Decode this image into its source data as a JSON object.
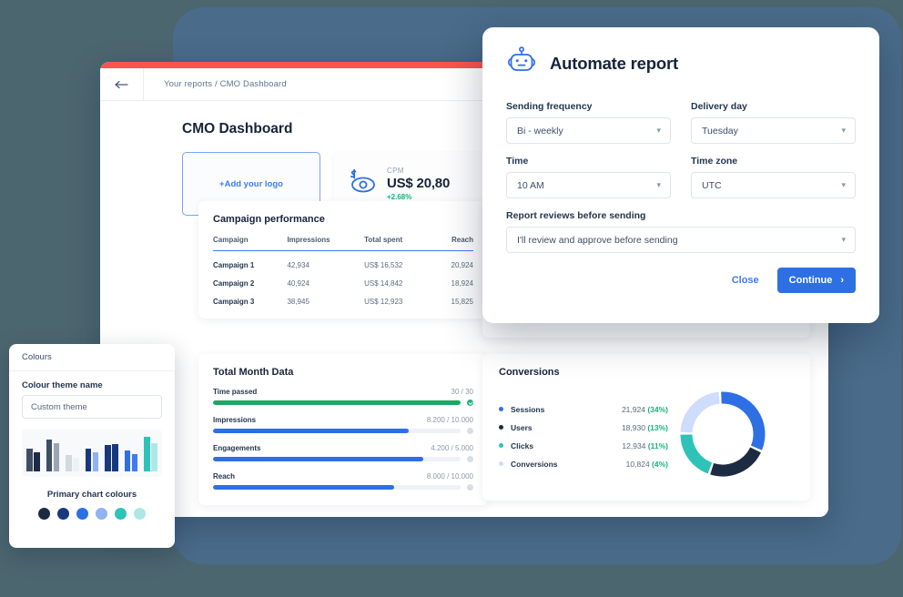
{
  "dashboard": {
    "breadcrumb": "Your reports / CMO Dashboard",
    "back_icon": "arrow-left-icon",
    "title": "CMO Dashboard",
    "logo_placeholder": "+Add your logo",
    "kpi": {
      "icon": "dollar-eye-icon",
      "label": "CPM",
      "value": "US$ 20,80",
      "delta": "+2.68%"
    },
    "campaign_panel": {
      "title": "Campaign performance",
      "columns": [
        "Campaign",
        "Impressions",
        "Total spent",
        "Reach"
      ],
      "rows": [
        [
          "Campaign 1",
          "42,934",
          "US$ 16,532",
          "20,924"
        ],
        [
          "Campaign 2",
          "40,924",
          "US$ 14,842",
          "18,924"
        ],
        [
          "Campaign 3",
          "38,945",
          "US$ 12,923",
          "15,825"
        ]
      ]
    },
    "month_panel": {
      "title": "Total Month Data",
      "rows": [
        {
          "name": "Time passed",
          "value": "30 / 30",
          "percent": 100,
          "color": "#1aa863",
          "complete": true
        },
        {
          "name": "Impressions",
          "value": "8.200 / 10.000",
          "percent": 79,
          "color": "#2f6fe4",
          "complete": false
        },
        {
          "name": "Engagements",
          "value": "4.200 / 5.000",
          "percent": 85,
          "color": "#2f6fe4",
          "complete": false
        },
        {
          "name": "Reach",
          "value": "8.000 / 10.000",
          "percent": 73,
          "color": "#2f6fe4",
          "complete": false
        }
      ]
    },
    "conversions_panel": {
      "title": "Conversions",
      "legend": [
        {
          "name": "Sessions",
          "value": "21,924",
          "percent": "(34%)",
          "color": "#2f6fe4"
        },
        {
          "name": "Users",
          "value": "18,930",
          "percent": "(13%)",
          "color": "#1d2b42"
        },
        {
          "name": "Clicks",
          "value": "12,934",
          "percent": "(11%)",
          "color": "#2fc2b8"
        },
        {
          "name": "Conversions",
          "value": "10,824",
          "percent": "(4%)",
          "color": "#cdddfb"
        }
      ]
    }
  },
  "chart_data": {
    "type": "pie",
    "title": "Conversions",
    "categories": [
      "Sessions",
      "Users",
      "Clicks",
      "Conversions"
    ],
    "values": [
      21924,
      18930,
      12934,
      10824
    ],
    "percent_labels": [
      "34%",
      "13%",
      "11%",
      "4%"
    ],
    "colors": [
      "#2f6fe4",
      "#1d2b42",
      "#2fc2b8",
      "#cdddfb"
    ],
    "donut": true,
    "segments_degrees": [
      118,
      85,
      72,
      85
    ],
    "legend_position": "left"
  },
  "modal": {
    "icon": "robot-icon",
    "title": "Automate report",
    "fields": [
      {
        "label": "Sending frequency",
        "value": "Bi - weekly",
        "icon": "chevron-down-icon"
      },
      {
        "label": "Delivery day",
        "value": "Tuesday",
        "icon": "chevron-down-icon"
      },
      {
        "label": "Time",
        "value": "10 AM",
        "icon": "chevron-down-icon"
      },
      {
        "label": "Time zone",
        "value": "UTC",
        "icon": "chevron-down-icon"
      }
    ],
    "review_field": {
      "label": "Report reviews before sending",
      "value": "I'll review and approve before sending",
      "icon": "chevron-down-icon"
    },
    "close_label": "Close",
    "continue_label": "Continue",
    "continue_icon": "chevron-right-icon"
  },
  "colours_panel": {
    "header": "Colours",
    "theme_label": "Colour theme name",
    "theme_value": "Custom theme",
    "theme_placeholder": "Custom theme",
    "primary_label": "Primary chart colours",
    "swatches": [
      "#1d2b42",
      "#173a7e",
      "#2f6fe4",
      "#91b3f5",
      "#2fc2b8",
      "#aee8e6"
    ],
    "preview_bars": [
      {
        "dark": "#3d4f66",
        "light": "#1d2b42",
        "h1": 62,
        "h2": 52
      },
      {
        "dark": "#3d4f66",
        "light": "#9aa6b6",
        "h1": 88,
        "h2": 78
      },
      {
        "dark": "#d3d9e1",
        "light": "#eef1f5",
        "h1": 46,
        "h2": 38
      },
      {
        "dark": "#173a7e",
        "light": "#91b3f5",
        "h1": 62,
        "h2": 52
      },
      {
        "dark": "#173a7e",
        "light": "#173a7e",
        "h1": 72,
        "h2": 74
      },
      {
        "dark": "#2f6fe4",
        "light": "#3f7bf2",
        "h1": 58,
        "h2": 48
      },
      {
        "dark": "#2fc2b8",
        "light": "#aee8e6",
        "h1": 96,
        "h2": 78
      }
    ]
  }
}
